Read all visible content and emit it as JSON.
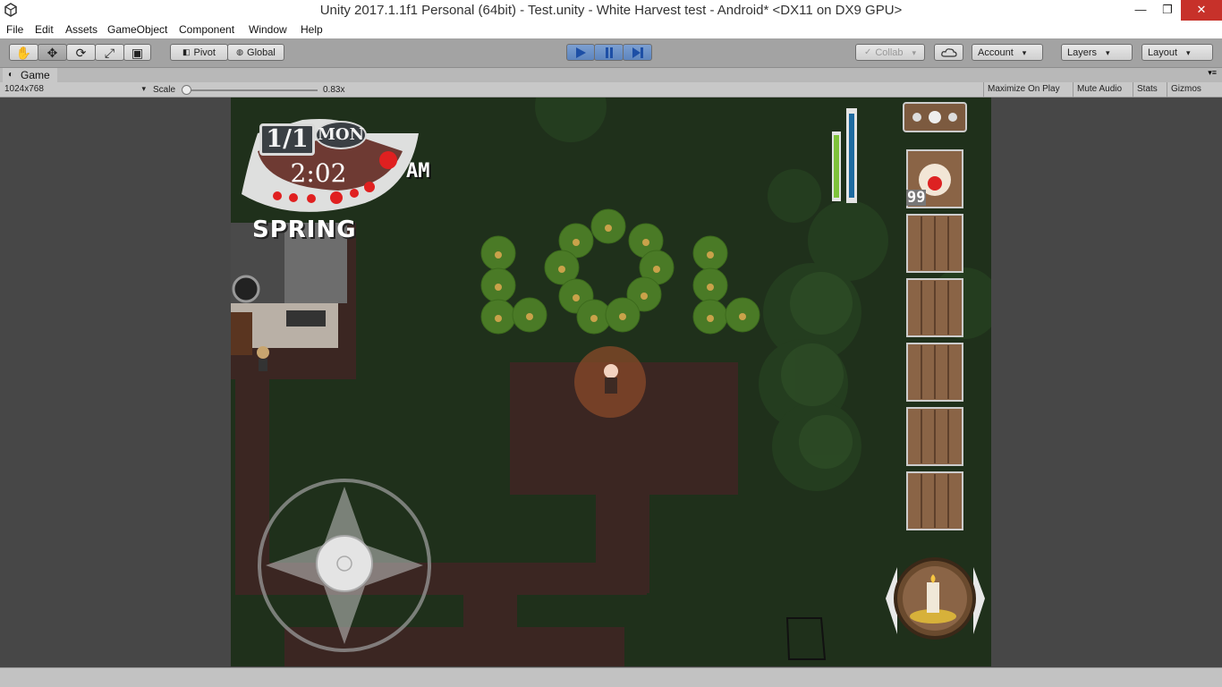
{
  "window": {
    "title": "Unity 2017.1.1f1 Personal (64bit) - Test.unity - White Harvest test - Android* <DX11 on DX9 GPU>"
  },
  "menu": [
    "File",
    "Edit",
    "Assets",
    "GameObject",
    "Component",
    "Window",
    "Help"
  ],
  "toolbar": {
    "pivot_label": "Pivot",
    "global_label": "Global",
    "collab_label": "Collab",
    "account_label": "Account",
    "layers_label": "Layers",
    "layout_label": "Layout"
  },
  "game_tab": {
    "label": "Game",
    "resolution": "1024x768",
    "scale_label": "Scale",
    "scale_value": "0.83x",
    "scale_fraction": 0.0,
    "options": [
      "Maximize On Play",
      "Mute Audio",
      "Stats",
      "Gizmos"
    ]
  },
  "hud": {
    "date": "1/1",
    "day": "MON",
    "time": "2:02",
    "ampm": "AM",
    "season": "SPRING",
    "item_quantity": "99"
  },
  "icons": {
    "unity": "unity-logo-icon",
    "hand": "hand-tool-icon",
    "move": "move-tool-icon",
    "rotate": "rotate-tool-icon",
    "scale": "scale-tool-icon",
    "rect": "rect-tool-icon",
    "play": "play-icon",
    "pause": "pause-icon",
    "step": "step-icon",
    "cloud": "cloud-icon"
  },
  "colors": {
    "play_active": "#5d85be",
    "grass": "#1d2d1a",
    "close": "#c7312a"
  }
}
